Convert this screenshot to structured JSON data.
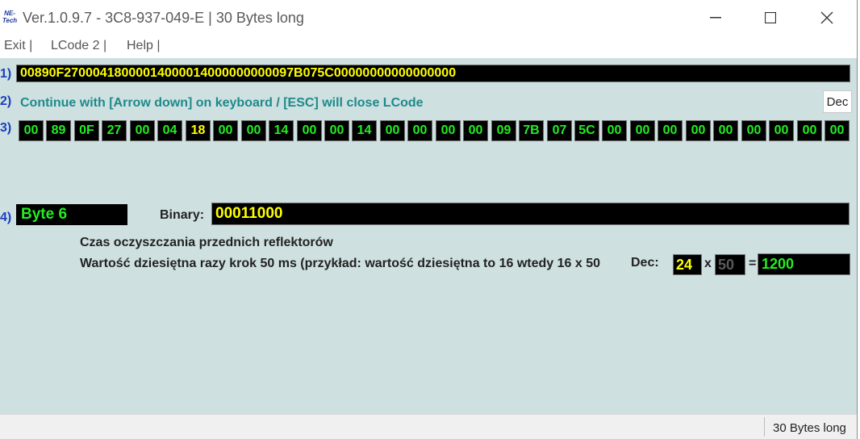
{
  "window": {
    "logo_text": "NE-Tech",
    "title": "Ver.1.0.9.7 -   3C8-937-049-E | 30 Bytes long",
    "controls": {
      "minimize": "—",
      "maximize": "☐",
      "close": "✕"
    }
  },
  "menu": {
    "items": [
      {
        "label": "Exit |"
      },
      {
        "label": "LCode 2 |"
      },
      {
        "label": "Help |"
      }
    ]
  },
  "row_numbers": {
    "r1": "1)",
    "r2": "2)",
    "r3": "3)",
    "r4": "4)"
  },
  "lcode_hex": "00890F27000418000014000014000000000097B075C00000000000000000",
  "hint": "Continue with [Arrow down] on keyboard / [ESC] will close LCode",
  "dec_button": "Dec",
  "bytes": [
    "00",
    "89",
    "0F",
    "27",
    "00",
    "04",
    "18",
    "00",
    "00",
    "14",
    "00",
    "00",
    "14",
    "00",
    "00",
    "00",
    "00",
    "09",
    "7B",
    "07",
    "5C",
    "00",
    "00",
    "00",
    "00",
    "00",
    "00",
    "00",
    "00",
    "00"
  ],
  "selected_byte_index": 6,
  "detail": {
    "byte_label": "Byte 6",
    "binary_label": "Binary:",
    "binary_value": "00011000",
    "desc_line1": "Czas oczyszczania przednich reflektorów",
    "desc_line2": "Wartość dziesiętna razy krok 50 ms (przykład: wartość dziesiętna to 16 wtedy 16 x 50",
    "dec_label": "Dec:",
    "dec_value": "24",
    "times": "x",
    "step_value": "50",
    "equals": "=",
    "result": "1200"
  },
  "status": {
    "text": "30 Bytes long"
  },
  "colors": {
    "background": "#cfe0e1",
    "hex_yellow": "#ffff00",
    "byte_green": "#22ee22",
    "hint_teal": "#1d8a8a",
    "number_blue": "#1a40c0"
  }
}
